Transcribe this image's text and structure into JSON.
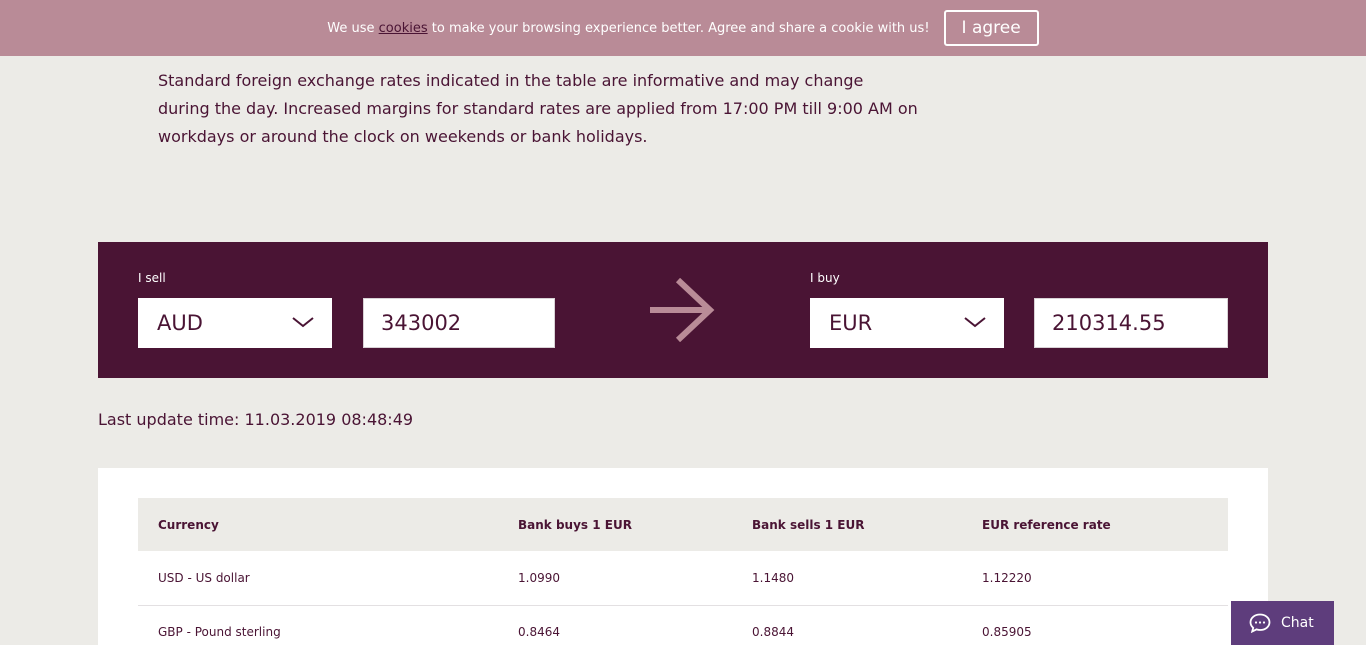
{
  "cookie_bar": {
    "text_before": "We use ",
    "link": "cookies",
    "text_after": " to make your browsing experience better. Agree and share a cookie with us!",
    "agree_label": "I agree"
  },
  "info_text": "Standard foreign exchange rates indicated in the table are informative and may change during the day. Increased margins for standard rates are applied from 17:00 PM till 9:00 AM on workdays or around the clock on weekends or bank holidays.",
  "converter": {
    "sell_label": "I sell",
    "sell_currency": "AUD",
    "sell_amount": "343002",
    "buy_label": "I buy",
    "buy_currency": "EUR",
    "buy_amount": "210314.55"
  },
  "last_update": "Last update time: 11.03.2019 08:48:49",
  "table": {
    "headers": [
      "Currency",
      "Bank buys 1 EUR",
      "Bank sells 1 EUR",
      "EUR reference rate"
    ],
    "rows": [
      [
        "USD - US dollar",
        "1.0990",
        "1.1480",
        "1.12220"
      ],
      [
        "GBP - Pound sterling",
        "0.8464",
        "0.8844",
        "0.85905"
      ]
    ]
  },
  "chat": {
    "label": "Chat"
  },
  "colors": {
    "brand": "#4a1434",
    "accent": "#b98b97",
    "chat": "#5e3d7c",
    "background": "#ecebe7"
  }
}
